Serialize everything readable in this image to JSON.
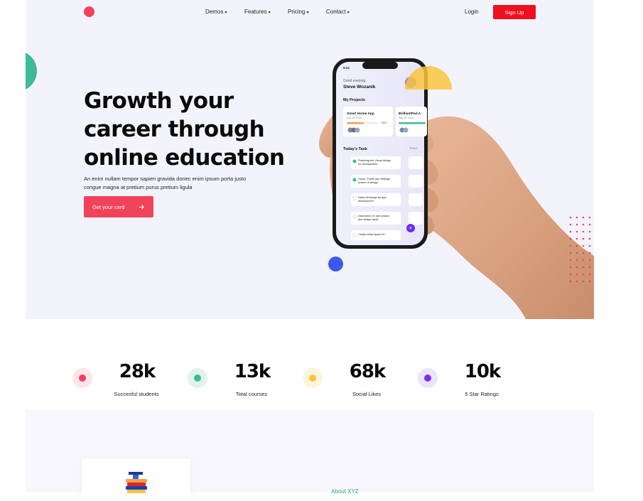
{
  "nav": {
    "items": [
      {
        "label": "Demos"
      },
      {
        "label": "Features"
      },
      {
        "label": "Pricing"
      },
      {
        "label": "Contact"
      }
    ],
    "login": "Login",
    "signup": "Sign Up"
  },
  "hero": {
    "headline": "Growth your career through online education",
    "subtext": "An enim nullam tempor sapien gravida donec enim ipsum porta justo congue magna at pretium purus pretium ligula",
    "cta": "Get your card"
  },
  "phone": {
    "time": "9:41",
    "greeting": "Good evening",
    "user": "Steve Wozanik",
    "projects_title": "My Projects",
    "projects": [
      {
        "name": "Smart Home App",
        "date": "Sep 15, 2019",
        "progress": "55%"
      },
      {
        "name": "BrilliantPad A",
        "date": "Sep 15, 2019"
      }
    ],
    "tasks_title": "Today's Task",
    "tasks_side": "Tomo",
    "tasks": [
      {
        "text": "Finalizing the Visual design for development"
      },
      {
        "text": "Home, Profile and Settings screen re-design"
      },
      {
        "text": "Hand-off design for app development"
      },
      {
        "text": "Discussion on new project and design tasks"
      },
      {
        "text": "Create initial layout for homepage design"
      }
    ]
  },
  "stats": [
    {
      "value": "28k",
      "label": "Succesful students",
      "color": "#f43f5e",
      "bg": "#fde5e8"
    },
    {
      "value": "13k",
      "label": "Total courses",
      "color": "#3dbb96",
      "bg": "#e0f2ec"
    },
    {
      "value": "68k",
      "label": "Social Likes",
      "color": "#f9c440",
      "bg": "#fdf4dc"
    },
    {
      "value": "10k",
      "label": "5 Star Ratings",
      "color": "#7c2ef0",
      "bg": "#ece4fb"
    }
  ],
  "about": {
    "link": "About XYZ"
  },
  "colors": {
    "accent_red": "#ee0f1f",
    "cta": "#f0435a",
    "teal": "#3dbb96",
    "blue": "#3a58f2",
    "hero_bg": "#f3f4fb"
  }
}
